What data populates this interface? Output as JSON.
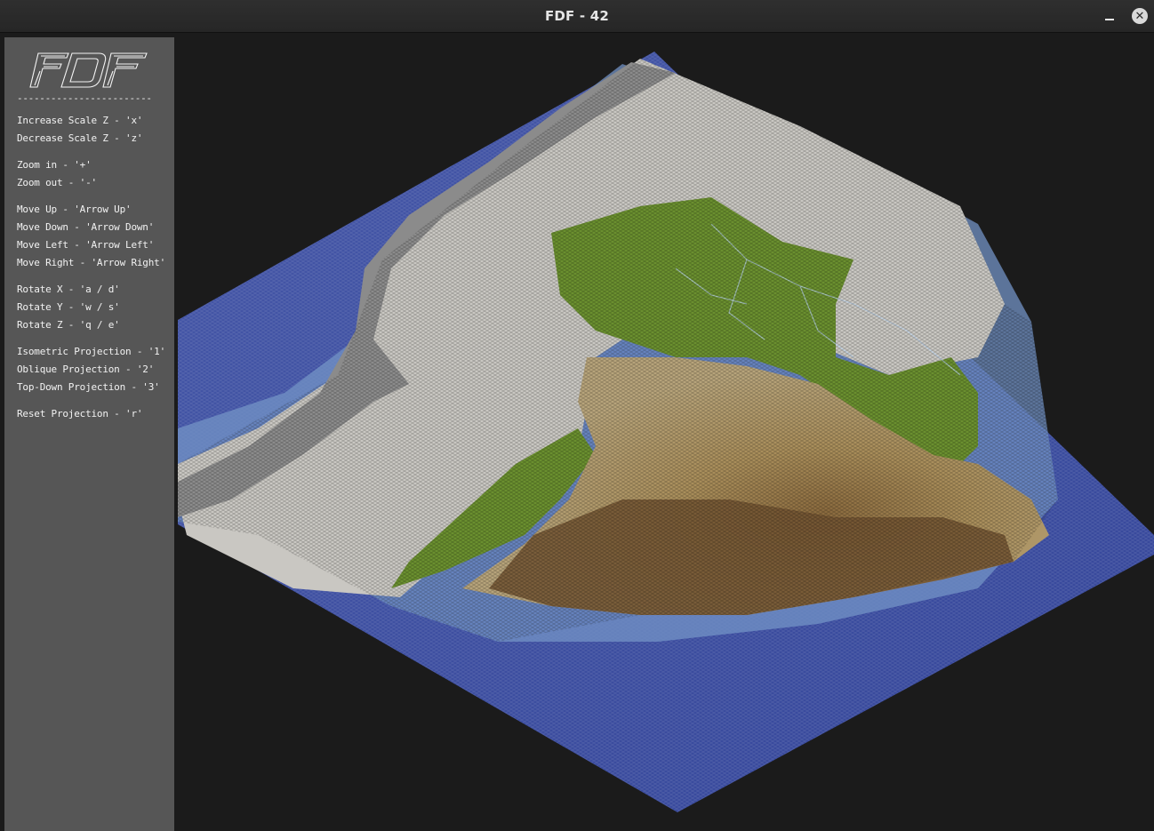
{
  "window": {
    "title": "FDF - 42",
    "minimize_icon": "minimize-icon",
    "close_icon": "close-icon",
    "close_glyph": "✕"
  },
  "sidebar": {
    "logo_text": "FDF",
    "divider": "------------------------",
    "controls": [
      "Increase Scale Z - 'x'",
      "Decrease Scale Z - 'z'",
      "Zoom in - '+'",
      "Zoom out - '-'",
      "Move Up - 'Arrow Up'",
      "Move Down - 'Arrow Down'",
      "Move Left - 'Arrow Left'",
      "Move Right - 'Arrow Right'",
      "Rotate X - 'a / d'",
      "Rotate Y - 'w / s'",
      "Rotate Z - 'q / e'",
      "Isometric Projection - '1'",
      "Oblique Projection - '2'",
      "Top-Down Projection - '3'",
      "Reset Projection - 'r'"
    ]
  },
  "colors": {
    "window_bg": "#1b1b1b",
    "sidebar_bg": "#565656",
    "ocean": "#3d4f9c",
    "shallow_water": "#6f8fc4",
    "lowland_green": "#5f8a2c",
    "highland_tan": "#b39a62",
    "mountain_brown": "#7a5a34",
    "peak_white": "#d8d8d8"
  }
}
